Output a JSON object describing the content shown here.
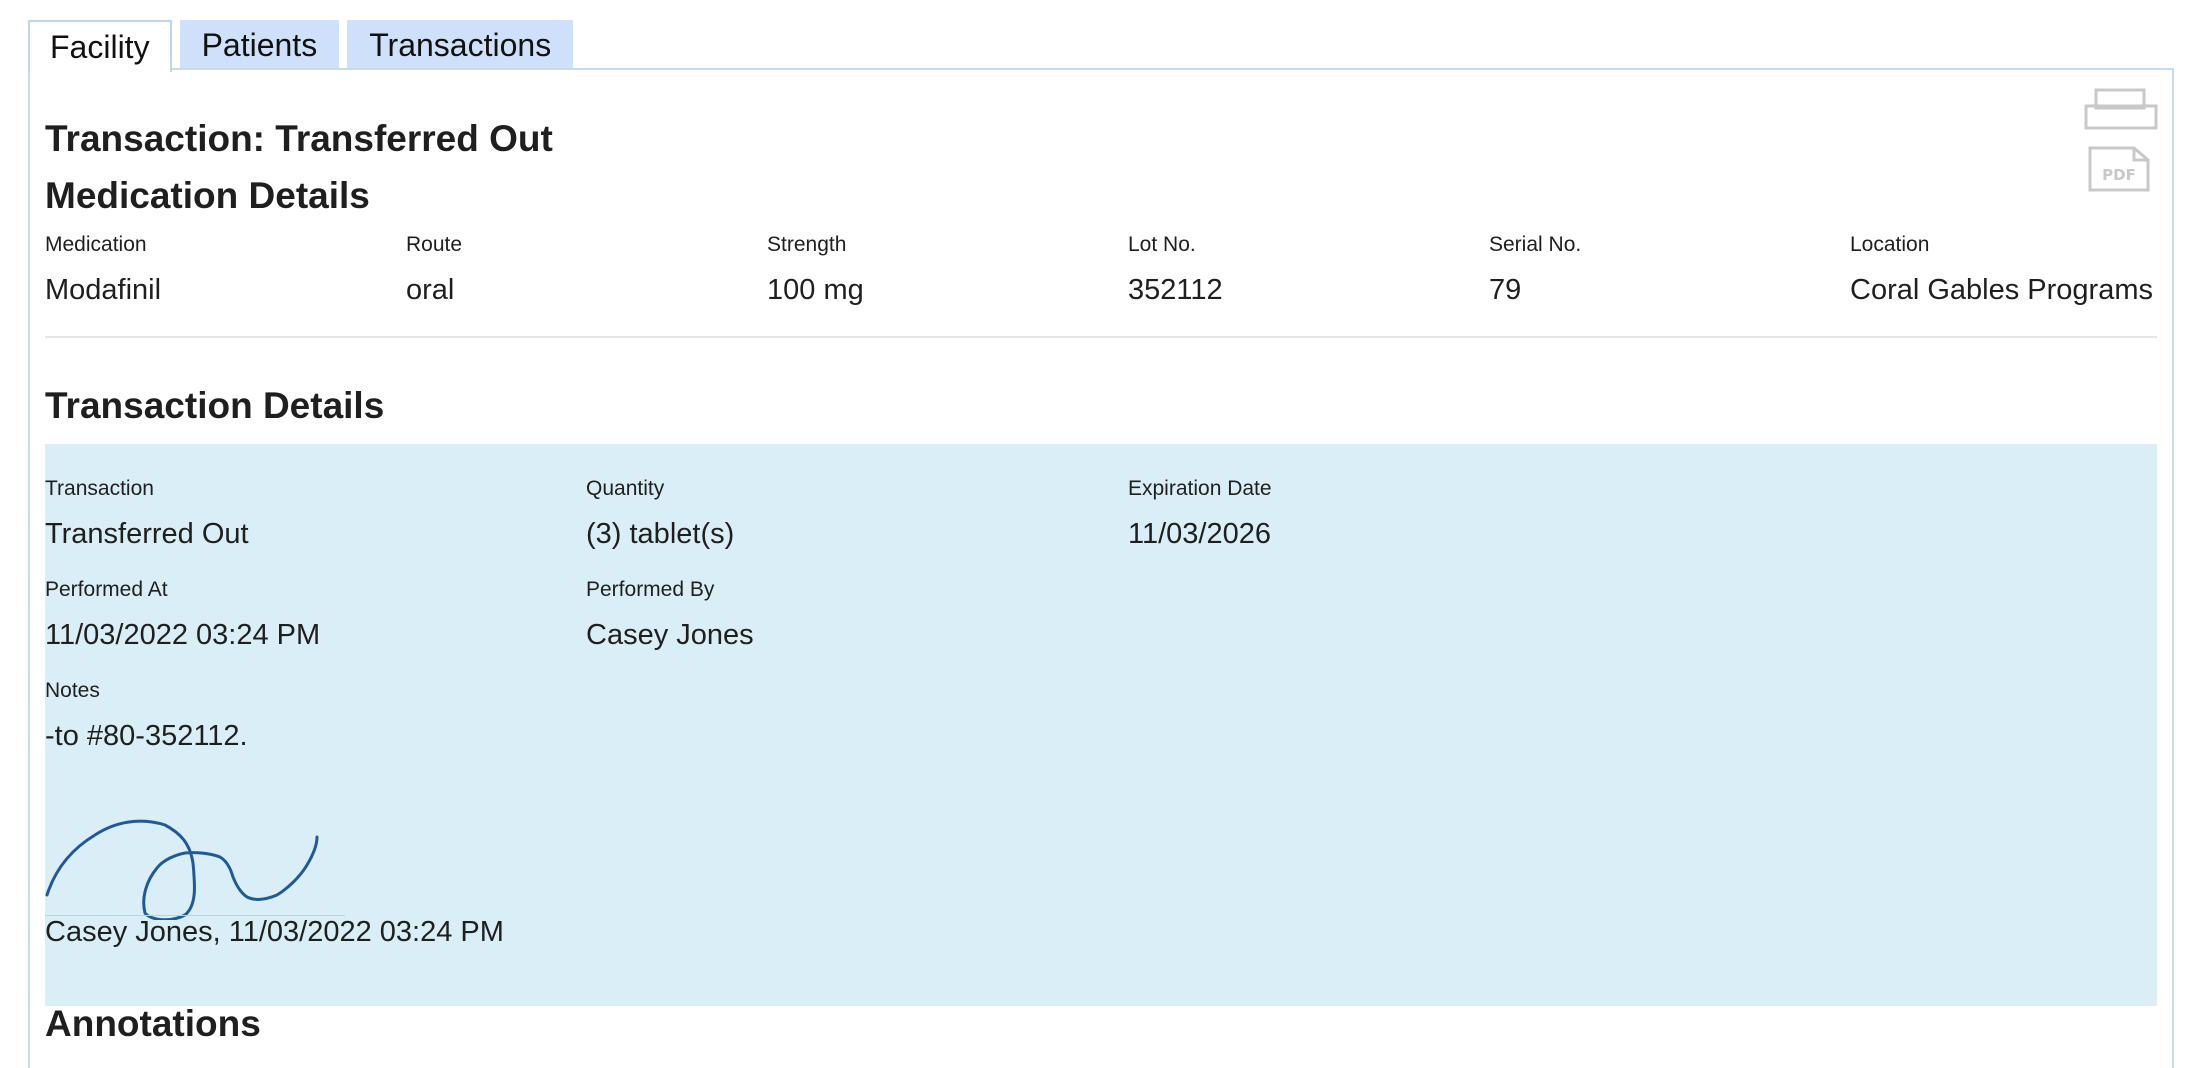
{
  "tabs": [
    {
      "label": "Facility",
      "active": true
    },
    {
      "label": "Patients",
      "active": false
    },
    {
      "label": "Transactions",
      "active": false
    }
  ],
  "toolbar": {
    "print_icon": "printer-icon",
    "pdf_icon": "pdf-icon",
    "pdf_text": "PDF"
  },
  "title": "Transaction: Transferred Out",
  "medication_details": {
    "heading": "Medication Details",
    "fields": [
      {
        "label": "Medication",
        "value": "Modafinil"
      },
      {
        "label": "Route",
        "value": "oral"
      },
      {
        "label": "Strength",
        "value": "100 mg"
      },
      {
        "label": "Lot No.",
        "value": "352112"
      },
      {
        "label": "Serial No.",
        "value": "79"
      },
      {
        "label": "Location",
        "value": "Coral Gables Programs"
      }
    ]
  },
  "transaction_details": {
    "heading": "Transaction Details",
    "transaction": {
      "label": "Transaction",
      "value": "Transferred Out"
    },
    "quantity": {
      "label": "Quantity",
      "value": "(3) tablet(s)"
    },
    "expiration": {
      "label": "Expiration Date",
      "value": "11/03/2026"
    },
    "performed_at": {
      "label": "Performed At",
      "value": "11/03/2022 03:24 PM"
    },
    "performed_by": {
      "label": "Performed By",
      "value": "Casey Jones"
    },
    "notes": {
      "label": "Notes",
      "value": "-to #80-352112."
    },
    "signature_caption": "Casey Jones, 11/03/2022 03:24 PM"
  },
  "annotations": {
    "heading": "Annotations"
  },
  "colors": {
    "tab_bg": "#cfe0fb",
    "panel_border": "#c5dcec",
    "details_bg": "#daeef7",
    "signature_ink": "#1f5a96"
  }
}
